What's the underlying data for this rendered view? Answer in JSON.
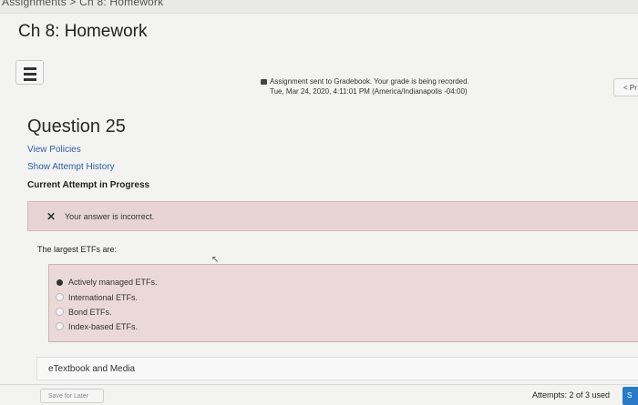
{
  "breadcrumb": "Assignments > Ch 8: Homework",
  "page_title": "Ch 8: Homework",
  "gradebook": {
    "line1": "Assignment sent to Gradebook. Your grade is being recorded.",
    "line2": "Tue, Mar 24, 2020, 4:11:01 PM (America/Indianapolis -04:00)"
  },
  "nav": {
    "prev_label": "< Pr"
  },
  "question": {
    "title": "Question 25",
    "view_policies": "View Policies",
    "show_history": "Show Attempt History",
    "current_attempt": "Current Attempt in Progress",
    "feedback": "Your answer is incorrect.",
    "prompt": "The largest ETFs are:",
    "options": [
      {
        "label": "Actively managed ETFs.",
        "selected": true
      },
      {
        "label": "International ETFs.",
        "selected": false
      },
      {
        "label": "Bond ETFs.",
        "selected": false
      },
      {
        "label": "Index-based ETFs.",
        "selected": false
      }
    ]
  },
  "media_label": "eTextbook and Media",
  "footer": {
    "save_later": "Save for Later",
    "attempts": "Attempts: 2 of 3 used",
    "submit_stub": "S"
  },
  "colors": {
    "incorrect_bg": "#e8d4d4",
    "link": "#2f5ea8",
    "submit": "#2a7ac8"
  }
}
